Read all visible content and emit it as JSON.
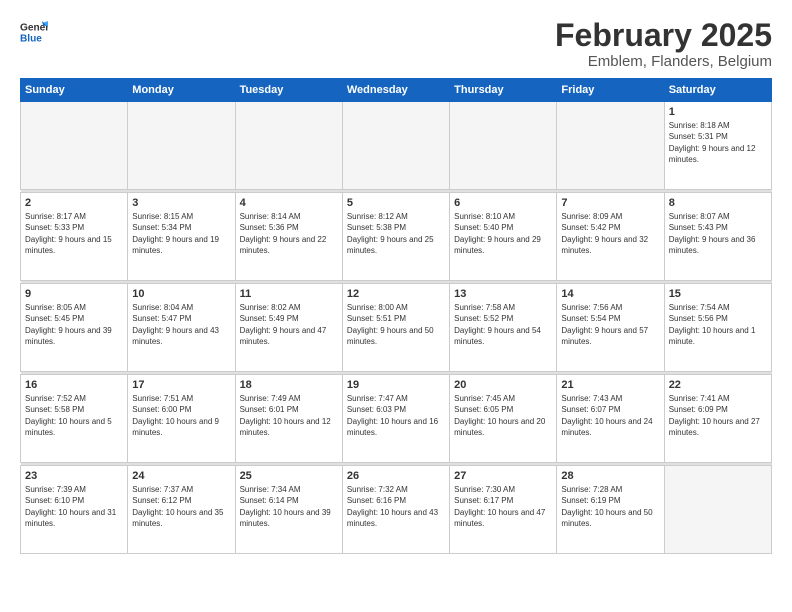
{
  "logo": {
    "general": "General",
    "blue": "Blue"
  },
  "title": "February 2025",
  "subtitle": "Emblem, Flanders, Belgium",
  "weekdays": [
    "Sunday",
    "Monday",
    "Tuesday",
    "Wednesday",
    "Thursday",
    "Friday",
    "Saturday"
  ],
  "weeks": [
    [
      {
        "day": "",
        "detail": "",
        "empty": true
      },
      {
        "day": "",
        "detail": "",
        "empty": true
      },
      {
        "day": "",
        "detail": "",
        "empty": true
      },
      {
        "day": "",
        "detail": "",
        "empty": true
      },
      {
        "day": "",
        "detail": "",
        "empty": true
      },
      {
        "day": "",
        "detail": "",
        "empty": true
      },
      {
        "day": "1",
        "detail": "Sunrise: 8:18 AM\nSunset: 5:31 PM\nDaylight: 9 hours and 12 minutes."
      }
    ],
    [
      {
        "day": "2",
        "detail": "Sunrise: 8:17 AM\nSunset: 5:33 PM\nDaylight: 9 hours and 15 minutes."
      },
      {
        "day": "3",
        "detail": "Sunrise: 8:15 AM\nSunset: 5:34 PM\nDaylight: 9 hours and 19 minutes."
      },
      {
        "day": "4",
        "detail": "Sunrise: 8:14 AM\nSunset: 5:36 PM\nDaylight: 9 hours and 22 minutes."
      },
      {
        "day": "5",
        "detail": "Sunrise: 8:12 AM\nSunset: 5:38 PM\nDaylight: 9 hours and 25 minutes."
      },
      {
        "day": "6",
        "detail": "Sunrise: 8:10 AM\nSunset: 5:40 PM\nDaylight: 9 hours and 29 minutes."
      },
      {
        "day": "7",
        "detail": "Sunrise: 8:09 AM\nSunset: 5:42 PM\nDaylight: 9 hours and 32 minutes."
      },
      {
        "day": "8",
        "detail": "Sunrise: 8:07 AM\nSunset: 5:43 PM\nDaylight: 9 hours and 36 minutes."
      }
    ],
    [
      {
        "day": "9",
        "detail": "Sunrise: 8:05 AM\nSunset: 5:45 PM\nDaylight: 9 hours and 39 minutes."
      },
      {
        "day": "10",
        "detail": "Sunrise: 8:04 AM\nSunset: 5:47 PM\nDaylight: 9 hours and 43 minutes."
      },
      {
        "day": "11",
        "detail": "Sunrise: 8:02 AM\nSunset: 5:49 PM\nDaylight: 9 hours and 47 minutes."
      },
      {
        "day": "12",
        "detail": "Sunrise: 8:00 AM\nSunset: 5:51 PM\nDaylight: 9 hours and 50 minutes."
      },
      {
        "day": "13",
        "detail": "Sunrise: 7:58 AM\nSunset: 5:52 PM\nDaylight: 9 hours and 54 minutes."
      },
      {
        "day": "14",
        "detail": "Sunrise: 7:56 AM\nSunset: 5:54 PM\nDaylight: 9 hours and 57 minutes."
      },
      {
        "day": "15",
        "detail": "Sunrise: 7:54 AM\nSunset: 5:56 PM\nDaylight: 10 hours and 1 minute."
      }
    ],
    [
      {
        "day": "16",
        "detail": "Sunrise: 7:52 AM\nSunset: 5:58 PM\nDaylight: 10 hours and 5 minutes."
      },
      {
        "day": "17",
        "detail": "Sunrise: 7:51 AM\nSunset: 6:00 PM\nDaylight: 10 hours and 9 minutes."
      },
      {
        "day": "18",
        "detail": "Sunrise: 7:49 AM\nSunset: 6:01 PM\nDaylight: 10 hours and 12 minutes."
      },
      {
        "day": "19",
        "detail": "Sunrise: 7:47 AM\nSunset: 6:03 PM\nDaylight: 10 hours and 16 minutes."
      },
      {
        "day": "20",
        "detail": "Sunrise: 7:45 AM\nSunset: 6:05 PM\nDaylight: 10 hours and 20 minutes."
      },
      {
        "day": "21",
        "detail": "Sunrise: 7:43 AM\nSunset: 6:07 PM\nDaylight: 10 hours and 24 minutes."
      },
      {
        "day": "22",
        "detail": "Sunrise: 7:41 AM\nSunset: 6:09 PM\nDaylight: 10 hours and 27 minutes."
      }
    ],
    [
      {
        "day": "23",
        "detail": "Sunrise: 7:39 AM\nSunset: 6:10 PM\nDaylight: 10 hours and 31 minutes."
      },
      {
        "day": "24",
        "detail": "Sunrise: 7:37 AM\nSunset: 6:12 PM\nDaylight: 10 hours and 35 minutes."
      },
      {
        "day": "25",
        "detail": "Sunrise: 7:34 AM\nSunset: 6:14 PM\nDaylight: 10 hours and 39 minutes."
      },
      {
        "day": "26",
        "detail": "Sunrise: 7:32 AM\nSunset: 6:16 PM\nDaylight: 10 hours and 43 minutes."
      },
      {
        "day": "27",
        "detail": "Sunrise: 7:30 AM\nSunset: 6:17 PM\nDaylight: 10 hours and 47 minutes."
      },
      {
        "day": "28",
        "detail": "Sunrise: 7:28 AM\nSunset: 6:19 PM\nDaylight: 10 hours and 50 minutes."
      },
      {
        "day": "",
        "detail": "",
        "empty": true
      }
    ]
  ]
}
